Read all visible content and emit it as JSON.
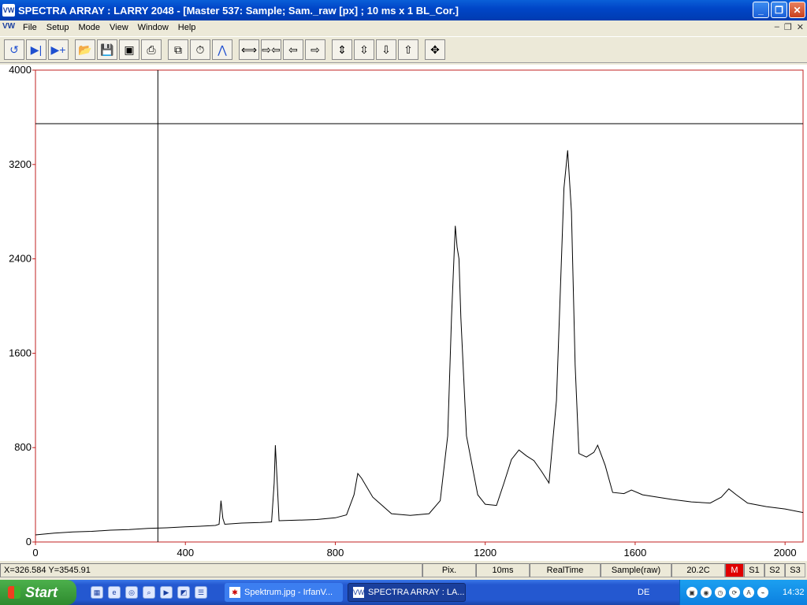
{
  "window": {
    "app_icon": "spectra-wave-icon",
    "title": "SPECTRA ARRAY : LARRY 2048  - [Master 537: Sample; Sam._raw [px] ; 10 ms x 1  BL_Cor.]"
  },
  "menu": {
    "items": [
      "File",
      "Setup",
      "Mode",
      "View",
      "Window",
      "Help"
    ]
  },
  "toolbar": {
    "icons": [
      "refresh-icon",
      "step-icon",
      "run-add-icon",
      "open-folder-icon",
      "save-icon",
      "image-icon",
      "print-icon",
      "copy-icon",
      "stopwatch-icon",
      "peak-icon",
      "expand-horizontal-icon",
      "shrink-horizontal-icon",
      "arrow-left-icon",
      "arrow-right-icon",
      "expand-vertical-icon",
      "shrink-vertical-icon",
      "arrow-down-icon",
      "arrow-up-icon",
      "move-icon"
    ]
  },
  "chart_data": {
    "type": "line",
    "x_ticks": [
      "0",
      "400",
      "800",
      "1200",
      "1600",
      "2000"
    ],
    "y_ticks": [
      "0",
      "800",
      "1600",
      "2400",
      "3200",
      "4000"
    ],
    "xlim": [
      0,
      2048
    ],
    "ylim": [
      0,
      4000
    ],
    "cursor": {
      "x": 326.584,
      "y": 3545.91
    },
    "series": [
      {
        "points": [
          [
            0,
            60
          ],
          [
            50,
            75
          ],
          [
            100,
            85
          ],
          [
            150,
            90
          ],
          [
            200,
            100
          ],
          [
            250,
            105
          ],
          [
            300,
            115
          ],
          [
            350,
            120
          ],
          [
            400,
            128
          ],
          [
            450,
            135
          ],
          [
            480,
            140
          ],
          [
            490,
            150
          ],
          [
            495,
            350
          ],
          [
            500,
            200
          ],
          [
            505,
            150
          ],
          [
            550,
            160
          ],
          [
            600,
            165
          ],
          [
            630,
            170
          ],
          [
            637,
            500
          ],
          [
            640,
            820
          ],
          [
            645,
            500
          ],
          [
            650,
            180
          ],
          [
            700,
            185
          ],
          [
            750,
            190
          ],
          [
            800,
            205
          ],
          [
            830,
            230
          ],
          [
            850,
            400
          ],
          [
            860,
            580
          ],
          [
            870,
            540
          ],
          [
            900,
            380
          ],
          [
            950,
            240
          ],
          [
            1000,
            225
          ],
          [
            1050,
            240
          ],
          [
            1080,
            350
          ],
          [
            1100,
            900
          ],
          [
            1110,
            1900
          ],
          [
            1120,
            2680
          ],
          [
            1125,
            2500
          ],
          [
            1130,
            2400
          ],
          [
            1135,
            1900
          ],
          [
            1150,
            900
          ],
          [
            1180,
            400
          ],
          [
            1200,
            320
          ],
          [
            1230,
            310
          ],
          [
            1250,
            500
          ],
          [
            1270,
            700
          ],
          [
            1290,
            780
          ],
          [
            1310,
            730
          ],
          [
            1330,
            690
          ],
          [
            1350,
            600
          ],
          [
            1370,
            500
          ],
          [
            1390,
            1200
          ],
          [
            1410,
            3000
          ],
          [
            1420,
            3320
          ],
          [
            1430,
            2800
          ],
          [
            1440,
            1500
          ],
          [
            1450,
            750
          ],
          [
            1470,
            720
          ],
          [
            1490,
            760
          ],
          [
            1500,
            820
          ],
          [
            1520,
            650
          ],
          [
            1540,
            420
          ],
          [
            1570,
            410
          ],
          [
            1590,
            440
          ],
          [
            1620,
            400
          ],
          [
            1700,
            360
          ],
          [
            1750,
            340
          ],
          [
            1800,
            330
          ],
          [
            1830,
            380
          ],
          [
            1850,
            450
          ],
          [
            1870,
            400
          ],
          [
            1900,
            330
          ],
          [
            1950,
            300
          ],
          [
            2000,
            280
          ],
          [
            2048,
            250
          ]
        ]
      }
    ]
  },
  "status": {
    "coords": "X=326.584  Y=3545.91",
    "unit": "Pix.",
    "time": "10ms",
    "mode": "RealTime",
    "source": "Sample(raw)",
    "temp": "20.2C",
    "m": "M",
    "s1": "S1",
    "s2": "S2",
    "s3": "S3"
  },
  "taskbar": {
    "start": "Start",
    "task1": "Spektrum.jpg - IrfanV...",
    "task2": "SPECTRA ARRAY : LA...",
    "lang": "DE",
    "clock": "14:32"
  }
}
